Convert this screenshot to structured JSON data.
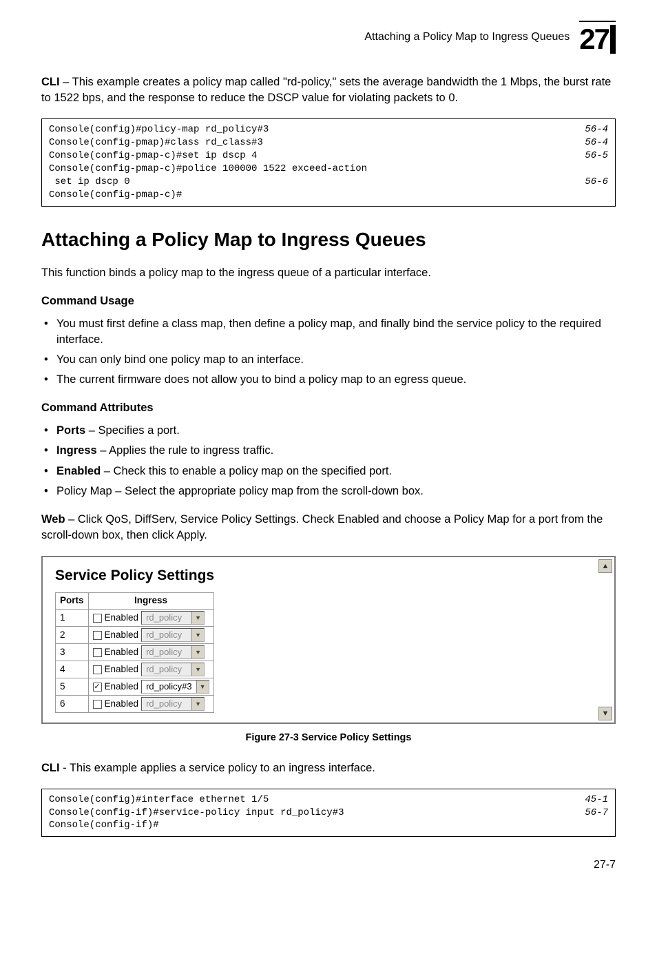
{
  "header": {
    "running_title": "Attaching a Policy Map to Ingress Queues",
    "chapter_number": "27"
  },
  "intro_cli": {
    "label": "CLI",
    "text": " – This example creates a policy map called \"rd-policy,\" sets the average bandwidth the 1 Mbps, the burst rate to 1522 bps, and the response to reduce the DSCP value for violating packets to 0."
  },
  "code1": [
    {
      "cmd": "Console(config)#policy-map rd_policy#3",
      "ref": "56-4"
    },
    {
      "cmd": "Console(config-pmap)#class rd_class#3",
      "ref": "56-4"
    },
    {
      "cmd": "Console(config-pmap-c)#set ip dscp 4",
      "ref": "56-5"
    },
    {
      "cmd": "Console(config-pmap-c)#police 100000 1522 exceed-action",
      "ref": ""
    },
    {
      "cmd": " set ip dscp 0",
      "ref": "56-6"
    },
    {
      "cmd": "Console(config-pmap-c)#",
      "ref": ""
    }
  ],
  "section_title": "Attaching a Policy Map to Ingress Queues",
  "section_intro": "This function binds a policy map to the ingress queue of a particular interface.",
  "usage_head": "Command Usage",
  "usage_items": [
    "You must first define a class map, then define a policy map, and finally bind the service policy to the required interface.",
    "You can only bind one policy map to an interface.",
    "The current firmware does not allow you to bind a policy map to an egress queue."
  ],
  "attr_head": "Command Attributes",
  "attr_items": [
    {
      "term": "Ports",
      "desc": " – Specifies a port."
    },
    {
      "term": "Ingress",
      "desc": " – Applies the rule to ingress traffic."
    },
    {
      "term": "Enabled",
      "desc": " – Check this to enable a policy map on the specified port."
    },
    {
      "term": "",
      "desc": "Policy Map – Select the appropriate policy map from the scroll-down box."
    }
  ],
  "web": {
    "label": "Web",
    "text": " – Click QoS, DiffServ, Service Policy Settings. Check Enabled and choose a Policy Map for a port from the scroll-down box, then click Apply."
  },
  "sps": {
    "title": "Service Policy Settings",
    "col_ports": "Ports",
    "col_ingress": "Ingress",
    "enabled_label": "Enabled",
    "rows": [
      {
        "port": "1",
        "checked": false,
        "policy": "rd_policy"
      },
      {
        "port": "2",
        "checked": false,
        "policy": "rd_policy"
      },
      {
        "port": "3",
        "checked": false,
        "policy": "rd_policy"
      },
      {
        "port": "4",
        "checked": false,
        "policy": "rd_policy"
      },
      {
        "port": "5",
        "checked": true,
        "policy": "rd_policy#3"
      },
      {
        "port": "6",
        "checked": false,
        "policy": "rd_policy"
      }
    ]
  },
  "figure_caption": "Figure 27-3  Service Policy Settings",
  "cli2": {
    "label": "CLI",
    "text": " - This example applies a service policy to an ingress interface."
  },
  "code2": [
    {
      "cmd": "Console(config)#interface ethernet 1/5",
      "ref": "45-1"
    },
    {
      "cmd": "Console(config-if)#service-policy input rd_policy#3",
      "ref": "56-7"
    },
    {
      "cmd": "Console(config-if)#",
      "ref": ""
    }
  ],
  "page_number": "27-7"
}
